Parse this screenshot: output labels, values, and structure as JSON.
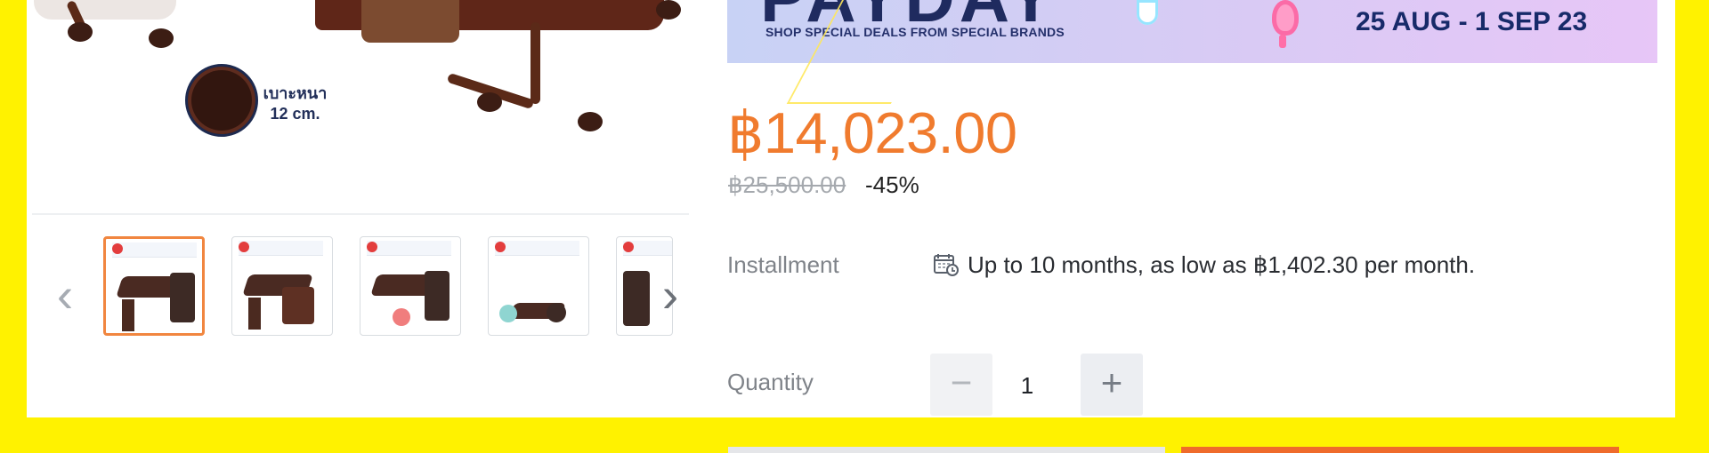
{
  "gallery": {
    "image_label": "เบาะหนา\n12 cm.",
    "thumbnail_arrows": {
      "previous": "‹",
      "next": "›"
    },
    "thumbnails": [
      {
        "name": "thumbnail-1",
        "selected": true
      },
      {
        "name": "thumbnail-2",
        "selected": false
      },
      {
        "name": "thumbnail-3",
        "selected": false
      },
      {
        "name": "thumbnail-4",
        "selected": false
      },
      {
        "name": "thumbnail-5",
        "selected": false
      }
    ]
  },
  "banner": {
    "headline": "PAYDAY",
    "subtitle": "SHOP SPECIAL DEALS FROM SPECIAL BRANDS",
    "date": "25 AUG - 1 SEP 23"
  },
  "price": {
    "current": "฿14,023.00",
    "original": "฿25,500.00",
    "discount": "-45%"
  },
  "installment": {
    "label": "Installment",
    "text": "Up to 10 months, as low as ฿1,402.30 per month.",
    "icon": "calendar-icon"
  },
  "quantity": {
    "label": "Quantity",
    "value": "1",
    "minus": "−",
    "plus": "+"
  },
  "colors": {
    "yellow_border": "#FFF200",
    "price_orange": "#F07B2E",
    "banner_navy": "#1F2B5F"
  }
}
